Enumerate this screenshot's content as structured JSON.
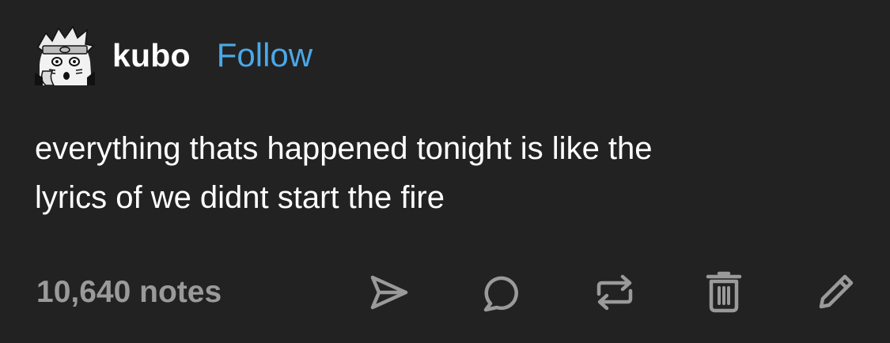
{
  "post": {
    "username": "kubo",
    "follow_label": "Follow",
    "body_lines": [
      "everything thats happened tonight is like the",
      "lyrics of we didnt start the fire"
    ],
    "notes": "10,640 notes",
    "actions": [
      "share-icon",
      "reply-icon",
      "reblog-icon",
      "delete-icon",
      "edit-icon"
    ]
  },
  "colors": {
    "background": "#222222",
    "text": "#ffffff",
    "follow": "#4aa8e8",
    "muted": "#9a9a9a"
  }
}
